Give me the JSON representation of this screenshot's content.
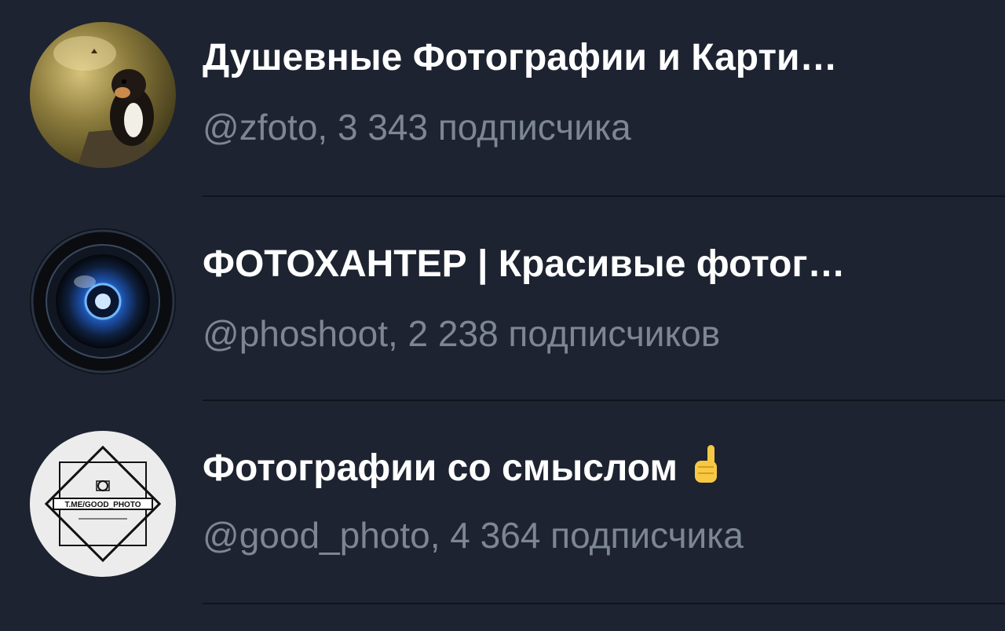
{
  "channels": [
    {
      "title": "Душевные Фотографии и Карти…",
      "subtitle": "@zfoto, 3 343 подписчика",
      "avatar_icon": "puppy-photo"
    },
    {
      "title": "ФОТОХАНТЕР | Красивые фотог…",
      "subtitle": "@phoshoot, 2 238 подписчиков",
      "avatar_icon": "camera-lens"
    },
    {
      "title": "Фотографии со смыслом",
      "title_emoji": "pointing-up-hand",
      "subtitle": "@good_photo, 4 364 подписчика",
      "avatar_icon": "good-photo-logo",
      "avatar_text": "T.ME/GOOD_PHOTO"
    }
  ],
  "colors": {
    "background": "#1d2330",
    "title": "#ffffff",
    "subtitle": "#7d8694",
    "divider": "#0f141c"
  }
}
